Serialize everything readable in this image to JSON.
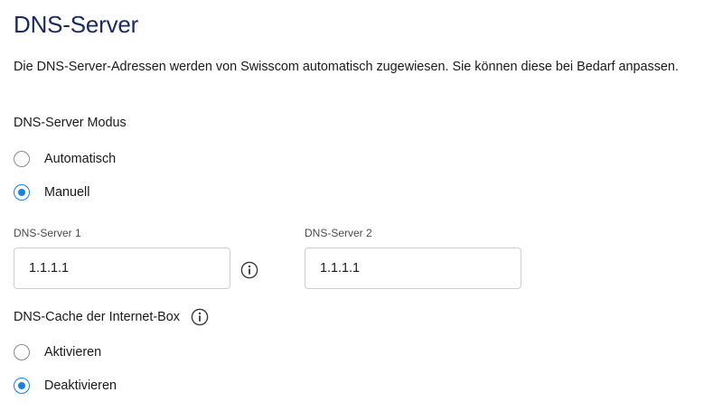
{
  "page": {
    "title": "DNS-Server",
    "intro": "Die DNS-Server-Adressen werden von Swisscom automatisch zugewiesen. Sie können diese bei Bedarf anpassen."
  },
  "dns_mode": {
    "label": "DNS-Server Modus",
    "options": [
      {
        "label": "Automatisch",
        "selected": false
      },
      {
        "label": "Manuell",
        "selected": true
      }
    ]
  },
  "dns_server_1": {
    "label": "DNS-Server 1",
    "value": "1.1.1.1",
    "info_icon": "info-icon"
  },
  "dns_server_2": {
    "label": "DNS-Server 2",
    "value": "1.1.1.1"
  },
  "dns_cache": {
    "label": "DNS-Cache der Internet-Box",
    "info_icon": "info-icon",
    "options": [
      {
        "label": "Aktivieren",
        "selected": false
      },
      {
        "label": "Deaktivieren",
        "selected": true
      }
    ]
  },
  "colors": {
    "title": "#1a2b5f",
    "accent": "#1781e3",
    "input_border": "#cfcfcf",
    "radio_border": "#8a8a8a"
  }
}
